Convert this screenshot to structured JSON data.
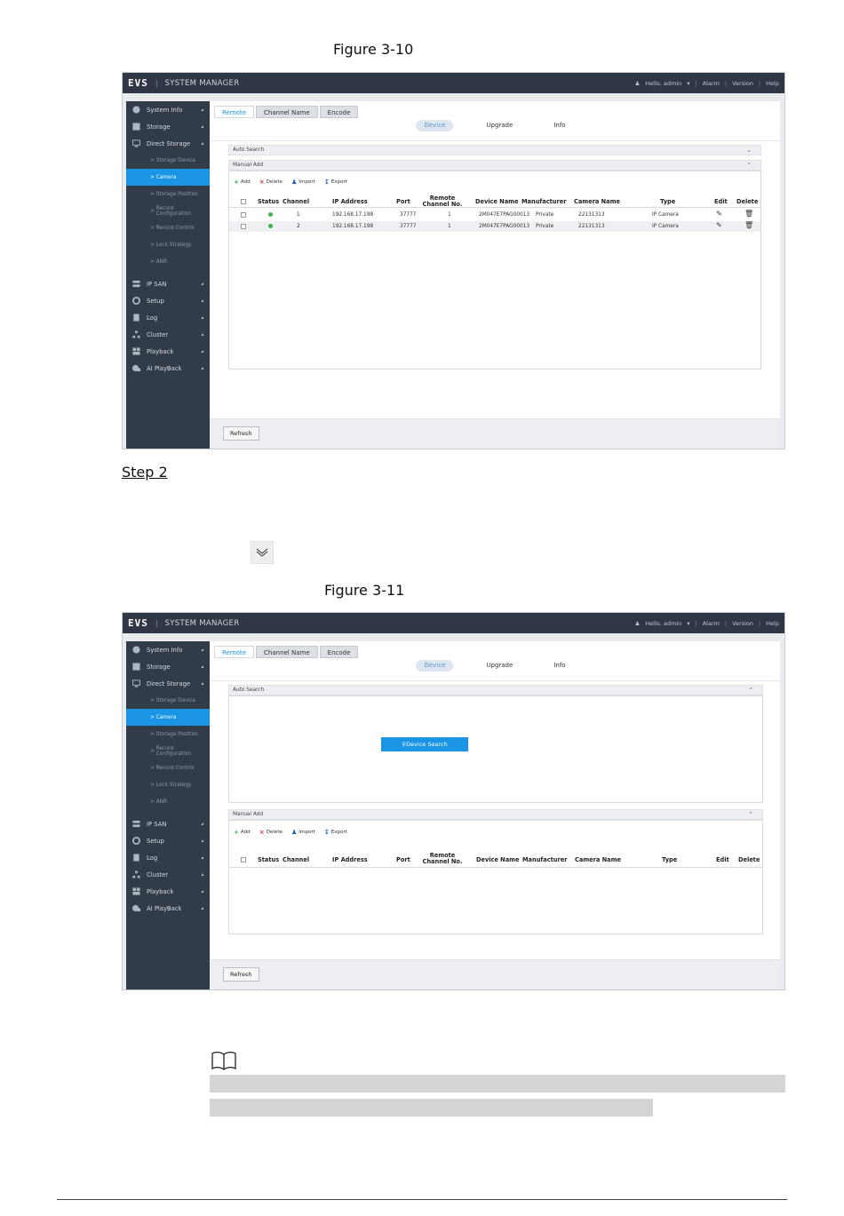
{
  "figure1": {
    "caption": "Figure 3-10"
  },
  "figure2": {
    "caption": "Figure 3-11"
  },
  "step": {
    "label": "Step 2"
  },
  "app": {
    "logo": "EVS",
    "title": "SYSTEM MANAGER",
    "user": "Hello, admin",
    "alarm": "Alarm",
    "version": "Version",
    "help": "Help"
  },
  "sidebar": {
    "items": [
      {
        "label": "System Info",
        "icon": "info-icon"
      },
      {
        "label": "Storage",
        "icon": "disk-icon"
      },
      {
        "label": "Direct Storage",
        "icon": "monitor-icon"
      }
    ],
    "subitems": [
      "Storage Device",
      "Camera",
      "Storage Position",
      "Record Configuration",
      "Record Control",
      "Lock Strategy",
      "ANR"
    ],
    "active_sub": "Camera",
    "items_after": [
      {
        "label": "IP SAN",
        "icon": "server-icon"
      },
      {
        "label": "Setup",
        "icon": "gear-icon"
      },
      {
        "label": "Log",
        "icon": "document-icon"
      },
      {
        "label": "Cluster",
        "icon": "cluster-icon"
      },
      {
        "label": "Playback",
        "icon": "playback-icon"
      },
      {
        "label": "AI PlayBack",
        "icon": "ai-playback-icon"
      }
    ]
  },
  "tabs": [
    "Remote",
    "Channel Name",
    "Encode"
  ],
  "subtabs": [
    "Device",
    "Upgrade",
    "Info"
  ],
  "panels": {
    "auto_search": "Auto Search",
    "manual_add": "Manual Add",
    "device_search_button": "Device Search"
  },
  "toolbar": {
    "add": "Add",
    "delete": "Delete",
    "import": "Import",
    "export": "Export"
  },
  "table": {
    "columns": [
      "Status",
      "Channel",
      "IP Address",
      "Port",
      "Remote Channel No.",
      "Device Name",
      "Manufacturer",
      "Camera Name",
      "Type",
      "Edit",
      "Delete"
    ],
    "rows": [
      {
        "channel": "1",
        "ip": "192.168.17.198",
        "port": "37777",
        "remote_channel": "1",
        "device_name": "2M047E7PAG00013",
        "manufacturer": "Private",
        "camera_name": "22131313",
        "type": "IP Camera"
      },
      {
        "channel": "2",
        "ip": "192.168.17.198",
        "port": "37777",
        "remote_channel": "1",
        "device_name": "2M047E7PAG00013",
        "manufacturer": "Private",
        "camera_name": "22131313",
        "type": "IP Camera"
      }
    ]
  },
  "refresh_button": "Refresh",
  "colors": {
    "accent": "#1a95e6",
    "sidebar": "#323b48",
    "topbar": "#2f3744",
    "status_ok": "#3cb44a"
  }
}
